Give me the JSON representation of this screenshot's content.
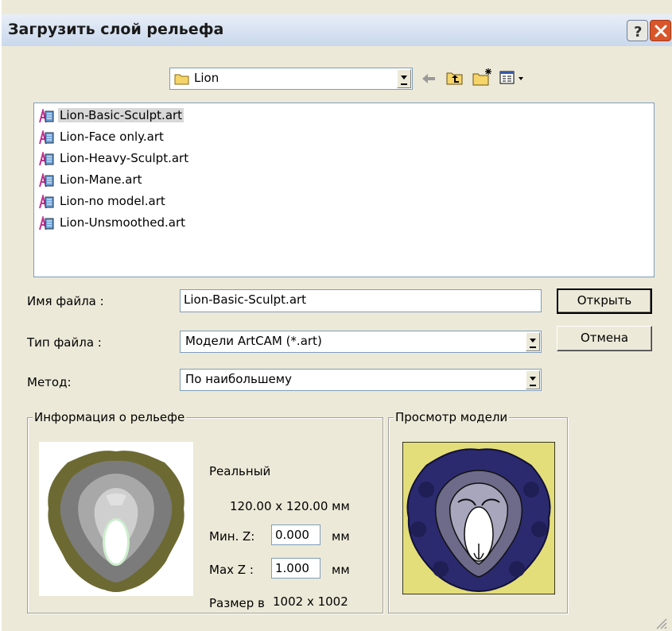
{
  "window": {
    "title": "Загрузить слой рельефа"
  },
  "titlebar": {
    "help_icon": "question-icon",
    "close_icon": "close-icon"
  },
  "toolbar": {
    "folder": "Lion",
    "icons": [
      "back-arrow-icon",
      "up-folder-icon",
      "new-folder-icon",
      "view-menu-icon"
    ]
  },
  "files": [
    {
      "name": "Lion-Basic-Sculpt.art",
      "selected": true
    },
    {
      "name": "Lion-Face only.art"
    },
    {
      "name": "Lion-Heavy-Sculpt.art"
    },
    {
      "name": "Lion-Mane.art"
    },
    {
      "name": "Lion-no model.art"
    },
    {
      "name": "Lion-Unsmoothed.art"
    }
  ],
  "form": {
    "filename_label": "Имя файла :",
    "filename_value": "Lion-Basic-Sculpt.art",
    "filetype_label": "Тип файла :",
    "filetype_value": "Модели ArtCAM (*.art)",
    "method_label": "Метод:",
    "method_value": "По наибольшему"
  },
  "buttons": {
    "open": "Открыть",
    "cancel": "Отмена"
  },
  "relief_info": {
    "group_title": "Информация о рельефе",
    "type": "Реальный",
    "dimensions": "120.00 x 120.00 мм",
    "min_z_label": "Мин. Z:",
    "min_z_value": "0.000",
    "min_z_unit": "мм",
    "max_z_label": "Max Z :",
    "max_z_value": "1.000",
    "max_z_unit": "мм",
    "size_label": "Размер в",
    "size_value": "1002 x 1002"
  },
  "preview": {
    "group_title": "Просмотр модели"
  },
  "colors": {
    "titlebar": "#c9d8ec",
    "dialog_bg": "#ece9d8",
    "close_button": "#d9562b",
    "preview_bg": "#e4de7a",
    "mane_dark": "#2b2a6e"
  }
}
